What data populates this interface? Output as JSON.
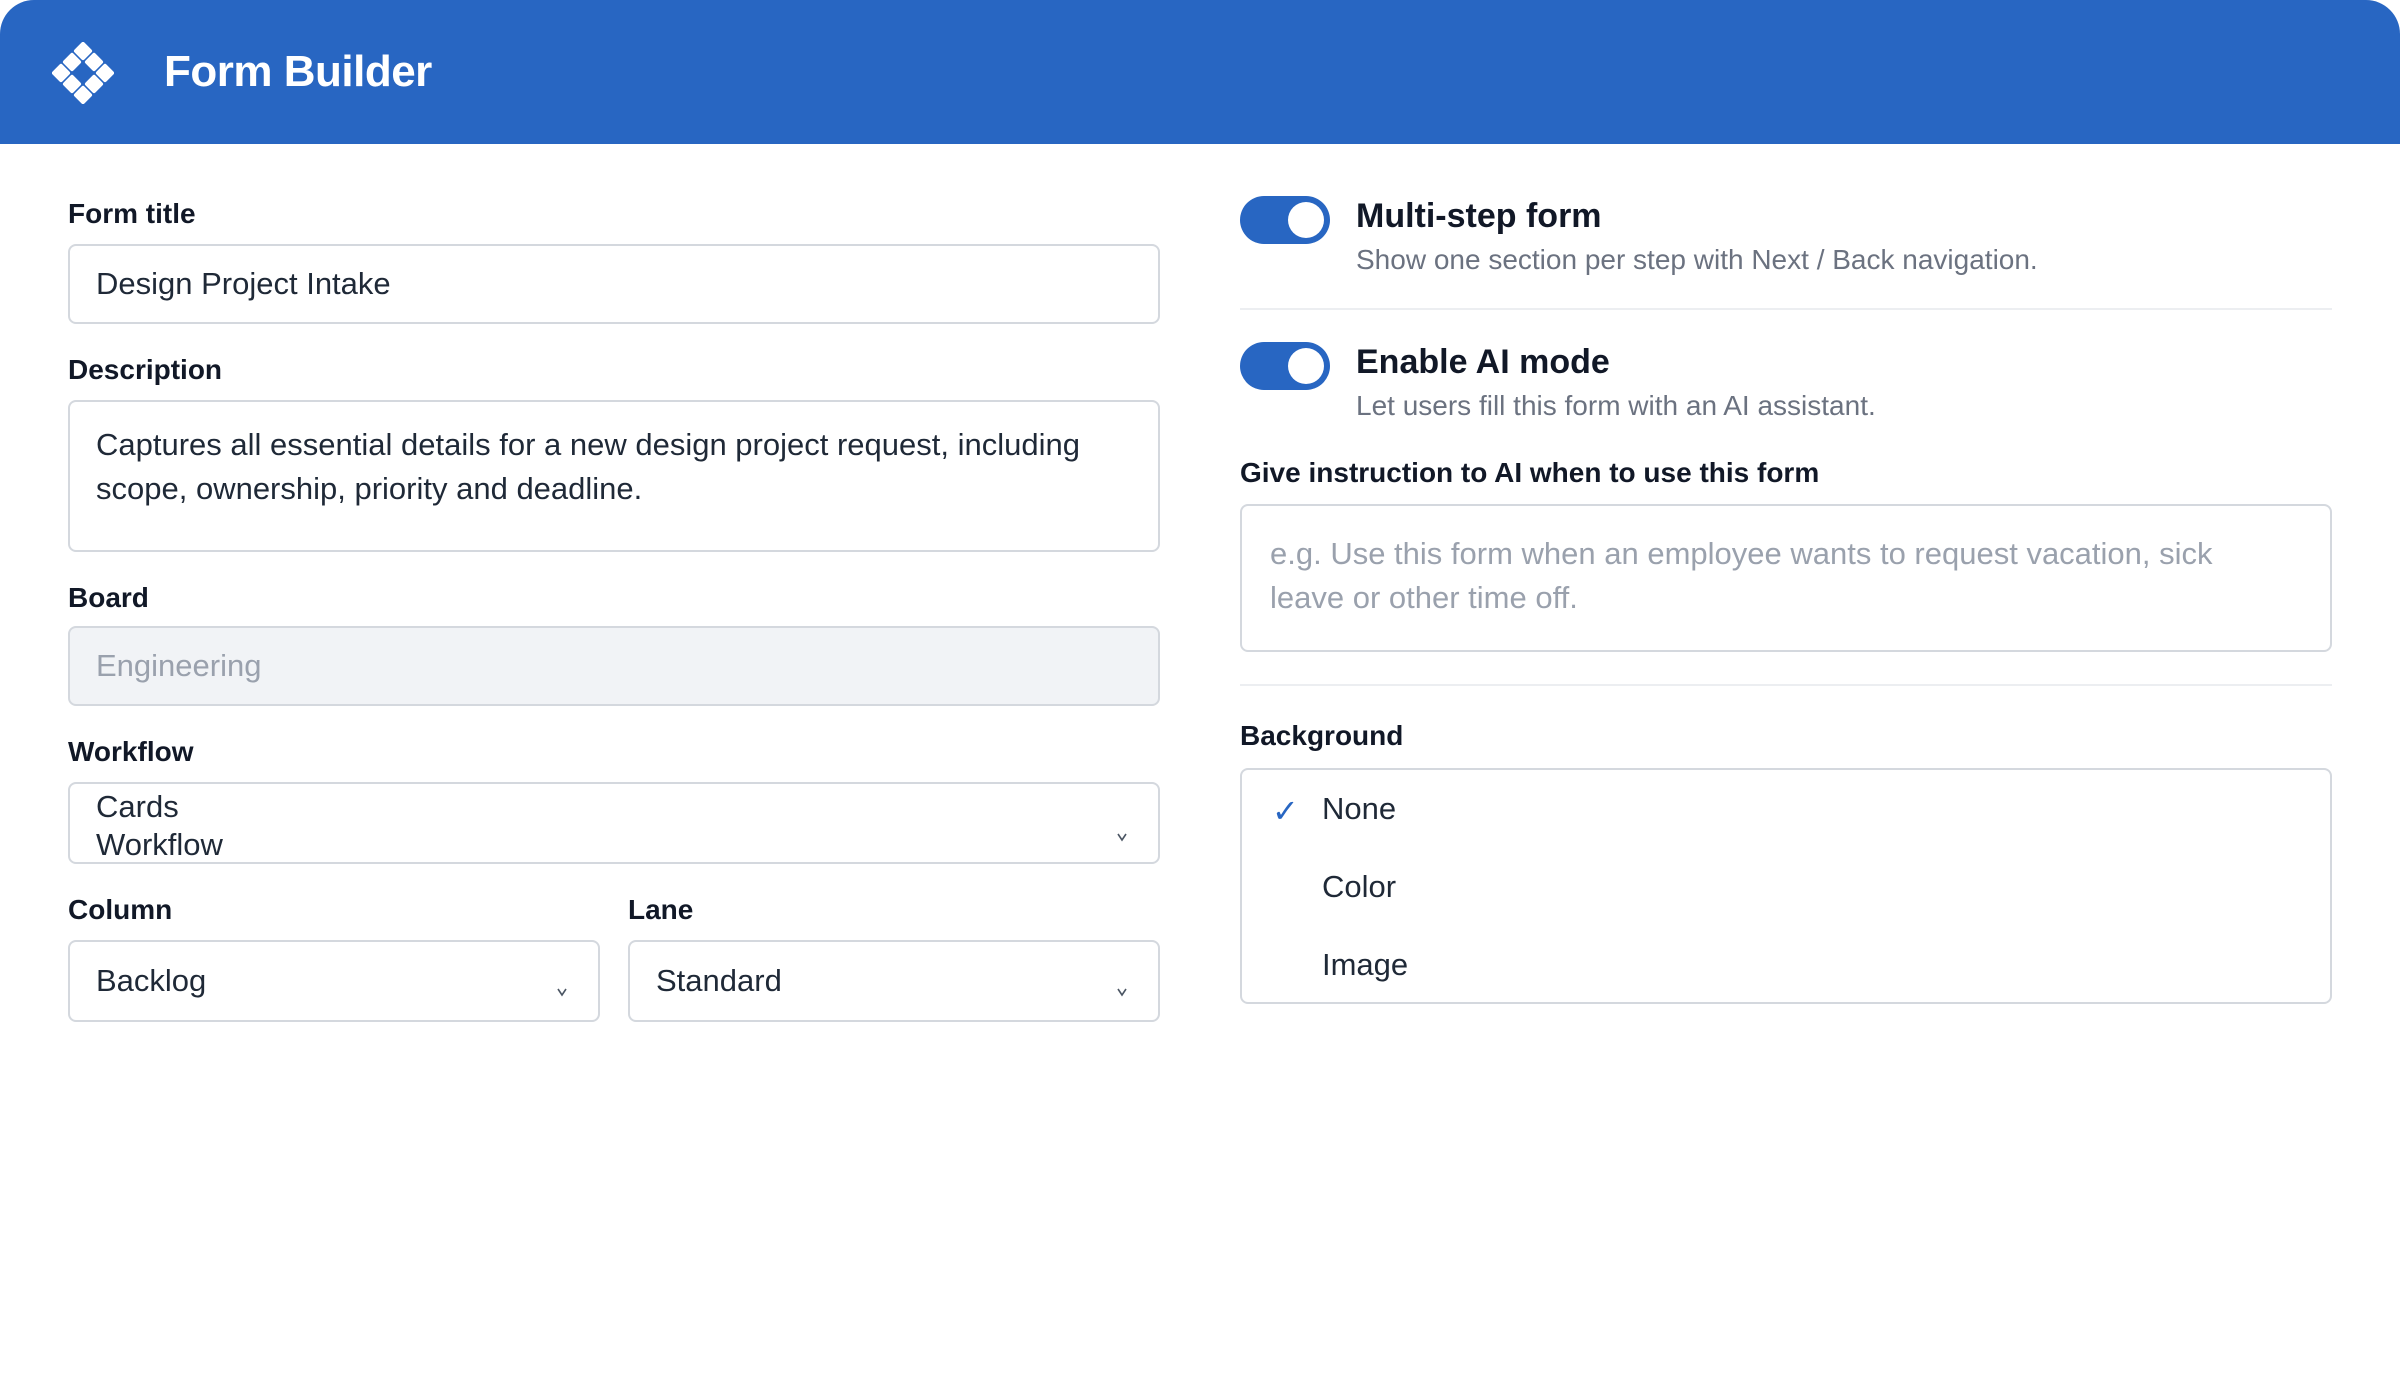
{
  "header": {
    "title": "Form Builder",
    "logo_icon": "diamond-grid-logo-icon",
    "color": "#2866c2"
  },
  "left": {
    "form_title": {
      "label": "Form title",
      "value": "Design Project Intake"
    },
    "description": {
      "label": "Description",
      "line1": "Captures all essential details for a new design project request, including",
      "line2": "scope, ownership, priority and deadline."
    },
    "board": {
      "label": "Board",
      "value": "Engineering"
    },
    "workflow": {
      "label": "Workflow",
      "value_line1": "Cards",
      "value_line2": "Workflow",
      "icon": "chevron-down-icon"
    },
    "column": {
      "label": "Column",
      "value": "Backlog",
      "icon": "chevron-down-icon"
    },
    "lane": {
      "label": "Lane",
      "value": "Standard",
      "icon": "chevron-down-icon"
    }
  },
  "right": {
    "multistep": {
      "title": "Multi-step form",
      "subtitle": "Show one section per step with Next / Back navigation.",
      "enabled": true
    },
    "ai_mode": {
      "title": "Enable AI mode",
      "subtitle": "Let users fill this form with an AI assistant.",
      "enabled": true
    },
    "ai_instruction": {
      "label": "Give instruction to AI when to use this form",
      "placeholder_line1": "e.g. Use this form when an employee wants to request vacation, sick",
      "placeholder_line2": "leave or other time off."
    },
    "background": {
      "label": "Background",
      "options": [
        {
          "label": "None",
          "selected": true,
          "check": "✓"
        },
        {
          "label": "Color",
          "selected": false
        },
        {
          "label": "Image",
          "selected": false
        }
      ]
    }
  }
}
